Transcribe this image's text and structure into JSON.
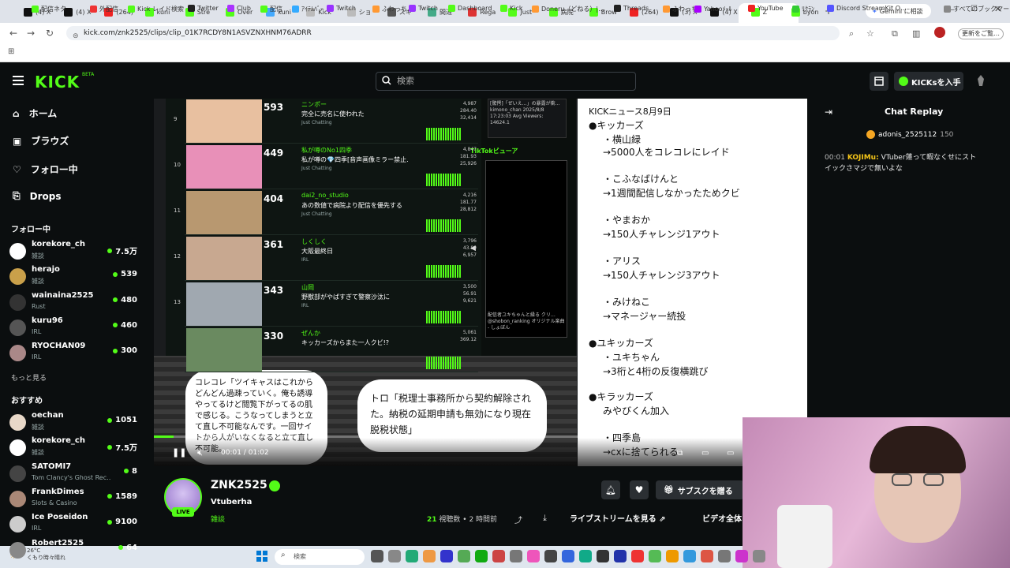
{
  "browser": {
    "tabs": [
      {
        "label": "(4) X",
        "color": "#111"
      },
      {
        "label": "(4) X",
        "color": "#111"
      },
      {
        "label": "(264)",
        "color": "#e22"
      },
      {
        "label": "kuni",
        "color": "#53fc18"
      },
      {
        "label": "Stre",
        "color": "#53fc18"
      },
      {
        "label": "Over",
        "color": "#53fc18"
      },
      {
        "label": "kuni",
        "color": "#4af"
      },
      {
        "label": "Kick",
        "color": "#bbb"
      },
      {
        "label": "ショ",
        "color": "#bbb"
      },
      {
        "label": "スキ",
        "color": "#555"
      },
      {
        "label": "間違",
        "color": "#4a8"
      },
      {
        "label": "Rega",
        "color": "#d33"
      },
      {
        "label": "Just",
        "color": "#53fc18"
      },
      {
        "label": "病院",
        "color": "#53fc18"
      },
      {
        "label": "Brow",
        "color": "#53fc18"
      },
      {
        "label": "(264)",
        "color": "#e22"
      },
      {
        "label": "(3) X",
        "color": "#111"
      },
      {
        "label": "(4) X",
        "color": "#111"
      },
      {
        "label": "Z",
        "color": "#53fc18"
      },
      {
        "label": "byon",
        "color": "#53fc18"
      }
    ],
    "gemini_label": "Gemini に相談",
    "url": "kick.com/znk2525/clips/clip_01K7RCDY8N1ASVZNXHNM76ADRR",
    "profile_label": "更新をご覧…",
    "bookmarks": [
      {
        "label": "配信ネタ",
        "color": "#53fc18"
      },
      {
        "label": "外配信",
        "color": "#e33"
      },
      {
        "label": "Kick レイド検索",
        "color": "#53fc18"
      },
      {
        "label": "Twitter",
        "color": "#222"
      },
      {
        "label": "Club",
        "color": "#a3f"
      },
      {
        "label": "配信",
        "color": "#53fc18"
      },
      {
        "label": "ｱｲﾃﾑﾊﾞｰ",
        "color": "#3af"
      },
      {
        "label": "Twitch",
        "color": "#93f"
      },
      {
        "label": "ふわっち",
        "color": "#f93"
      },
      {
        "label": "Twitch",
        "color": "#93f"
      },
      {
        "label": "Dashboard",
        "color": "#53fc18"
      },
      {
        "label": "Kick",
        "color": "#53fc18"
      },
      {
        "label": "Doneru（どねる）|…",
        "color": "#f93"
      },
      {
        "label": "Threads",
        "color": "#222"
      },
      {
        "label": "ふわっち",
        "color": "#f93"
      },
      {
        "label": "Yahooﾒｰﾙ",
        "color": "#a0f"
      },
      {
        "label": "YouTube",
        "color": "#e22"
      },
      {
        "label": "ﾘｸﾗﾝ",
        "color": "#3c3"
      },
      {
        "label": "Discord StreamKit O…",
        "color": "#55f"
      },
      {
        "label": "すべてのブックマーク",
        "color": "#888"
      }
    ]
  },
  "header": {
    "logo": "KICK",
    "logo_sup": "BETA",
    "search_placeholder": "検索",
    "kicks_button": "KICKsを入手"
  },
  "sidebar": {
    "nav": [
      {
        "label": "ホーム"
      },
      {
        "label": "ブラウズ"
      },
      {
        "label": "フォロー中"
      },
      {
        "label": "Drops"
      }
    ],
    "following_title": "フォロー中",
    "following": [
      {
        "name": "korekore_ch",
        "cat": "雑談",
        "count": "7.5万",
        "color": "#fff"
      },
      {
        "name": "herajo",
        "cat": "雑談",
        "count": "539",
        "color": "#c9a04a"
      },
      {
        "name": "wainaina2525",
        "cat": "Rust",
        "count": "480",
        "color": "#333"
      },
      {
        "name": "kuru96",
        "cat": "IRL",
        "count": "460",
        "color": "#555"
      },
      {
        "name": "RYOCHAN09",
        "cat": "IRL",
        "count": "300",
        "color": "#a88"
      }
    ],
    "more": "もっと見る",
    "recommended_title": "おすすめ",
    "recommended": [
      {
        "name": "oechan",
        "cat": "雑談",
        "count": "1051",
        "color": "#e8d8c8"
      },
      {
        "name": "korekore_ch",
        "cat": "雑談",
        "count": "7.5万",
        "color": "#fff"
      },
      {
        "name": "SATOMI7",
        "cat": "Tom Clancy's Ghost Rec…",
        "count": "8",
        "color": "#444"
      },
      {
        "name": "FrankDimes",
        "cat": "Slots & Casino",
        "count": "1589",
        "color": "#a87"
      },
      {
        "name": "Ice Poseidon",
        "cat": "IRL",
        "count": "9100",
        "color": "#ccc"
      },
      {
        "name": "Robert2525",
        "cat": "",
        "count": "64",
        "color": "#888"
      }
    ]
  },
  "video": {
    "ranking": [
      {
        "num": "593",
        "name": "ニンポー",
        "title": "完全に売名に使われた",
        "cat": "Just Chatting",
        "stat1": "4,987",
        "stat2": "284.40",
        "stat3": "32,414",
        "rank": "9",
        "color": "#e8c0a0"
      },
      {
        "num": "449",
        "name": "私が噂のNo1四季",
        "title": "私が噂の💎四季[音声画像ミラー禁止…",
        "cat": "Just Chatting",
        "stat1": "4,847",
        "stat2": "181.93",
        "stat3": "25,926",
        "rank": "10",
        "color": "#e890b8"
      },
      {
        "num": "404",
        "name": "dai2_no_studio",
        "title": "あの数値で病院より配信を優先する",
        "cat": "Just Chatting",
        "stat1": "4,216",
        "stat2": "181.77",
        "stat3": "28,812",
        "rank": "11",
        "color": "#b89870"
      },
      {
        "num": "361",
        "name": "しくしく",
        "title": "大阪最終日",
        "cat": "IRL",
        "stat1": "3,796",
        "stat2": "43.89",
        "stat3": "6,957",
        "rank": "12",
        "color": "#c8a890"
      },
      {
        "num": "343",
        "name": "山岡",
        "title": "野獣部がやばすぎて警察沙汰に",
        "cat": "IRL",
        "stat1": "3,500",
        "stat2": "56.91",
        "stat3": "9,621",
        "rank": "13",
        "color": "#a0a8b0"
      },
      {
        "num": "330",
        "name": "ぜんか",
        "title": "キッカーズからまた一人クビ!?",
        "cat": "",
        "stat1": "5,061",
        "stat2": "369.12",
        "stat3": "",
        "rank": "",
        "color": "#6a8a60"
      }
    ],
    "tiktok_top": "[驚愕]「ぜいえ…」の暴露が衝… kimono_chan 2025/8/8 17:23:03 Avg Viewers: 14624.1",
    "tiktok_label": "TikTokビューア",
    "tiktok_caption": "配信者ユキちゃんと縁る クリ… @shobon_ranking オリジナル楽曲 - しょぼん",
    "news_lines": [
      "KICKニュース8月9日",
      "●キッカーズ",
      "・横山緑",
      "→5000人をコレコレにレイド",
      "・こふなばけんと",
      "→1週間配信しなかったためクビ",
      "・やまおか",
      "→150人チャレンジ1アウト",
      "・アリス",
      "→150人チャレンジ3アウト",
      "・みけねこ",
      "→マネージャー続投",
      "●ユキッカーズ",
      "・ユキちゃん",
      "→3桁と4桁の反復横跳び",
      "●キラッカーズ",
      "みやびくん加入",
      "・四季島",
      "→cxに捨てられる"
    ],
    "bubble1": "コレコレ「ツイキャスはこれからどんどん過疎っていく。俺も誘導やってるけど閲覧下がってるの肌で感じる。こうなってしまうと立て直し不可能なんです。一回サイトから人がいなくなると立て直し不可能。",
    "bubble2": "トロ「税理士事務所から契約解除された。納税の延期申請も無効になり現在脱税状態」",
    "time": "00:01 / 01:02",
    "progress": 0.03
  },
  "channel": {
    "name": "ZNK2525",
    "title": "Vtuberha",
    "category": "雑談",
    "live": "LIVE",
    "views_num": "21",
    "views_label": "視聴数",
    "ago": "2 時間前",
    "gift_button": "サブスクを贈る",
    "livestream_button": "ライブストリームを見る",
    "vod_button": "ビデオ全体"
  },
  "chat": {
    "title": "Chat Replay",
    "pinned_user": "adonis_2525112",
    "pinned_count": "150",
    "time": "00:01",
    "user": "KOJIMu:",
    "message": "VTuber蓮って暇なくせにストイックさマジで無いよな"
  },
  "taskbar": {
    "temp": "26°C",
    "weather": "くもり時々晴れ",
    "search": "検索"
  }
}
